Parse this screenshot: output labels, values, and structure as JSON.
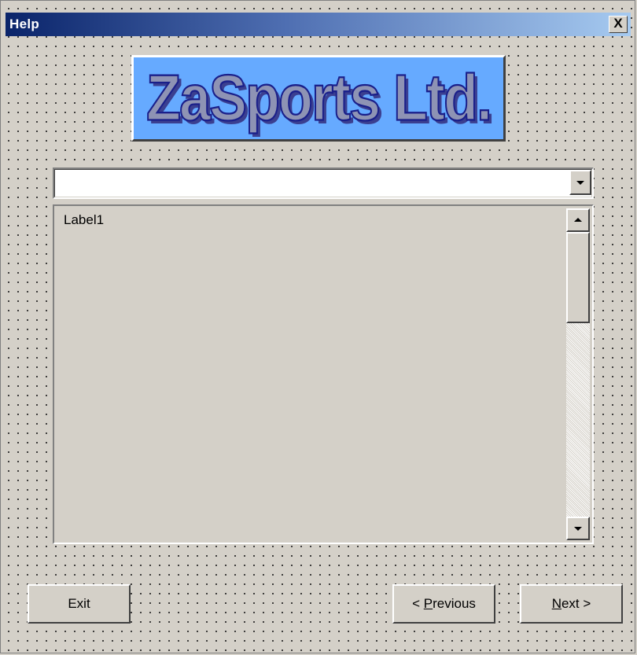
{
  "window": {
    "title": "Help",
    "close_label": "X"
  },
  "logo": {
    "text": "ZaSports Ltd."
  },
  "topic_select": {
    "value": ""
  },
  "content": {
    "label": "Label1"
  },
  "buttons": {
    "exit": "Exit",
    "previous_prefix": "< ",
    "previous_mnemonic": "P",
    "previous_rest": "revious",
    "next_mnemonic": "N",
    "next_rest": "ext >"
  },
  "colors": {
    "titlebar_start": "#0a246a",
    "titlebar_end": "#a6caf0",
    "logo_background": "#66aaff",
    "form_background": "#d4d0c8"
  },
  "icons": {
    "close": "close-icon",
    "dropdown": "chevron-down-icon",
    "scroll_up": "scroll-up-arrow-icon",
    "scroll_down": "scroll-down-arrow-icon"
  }
}
